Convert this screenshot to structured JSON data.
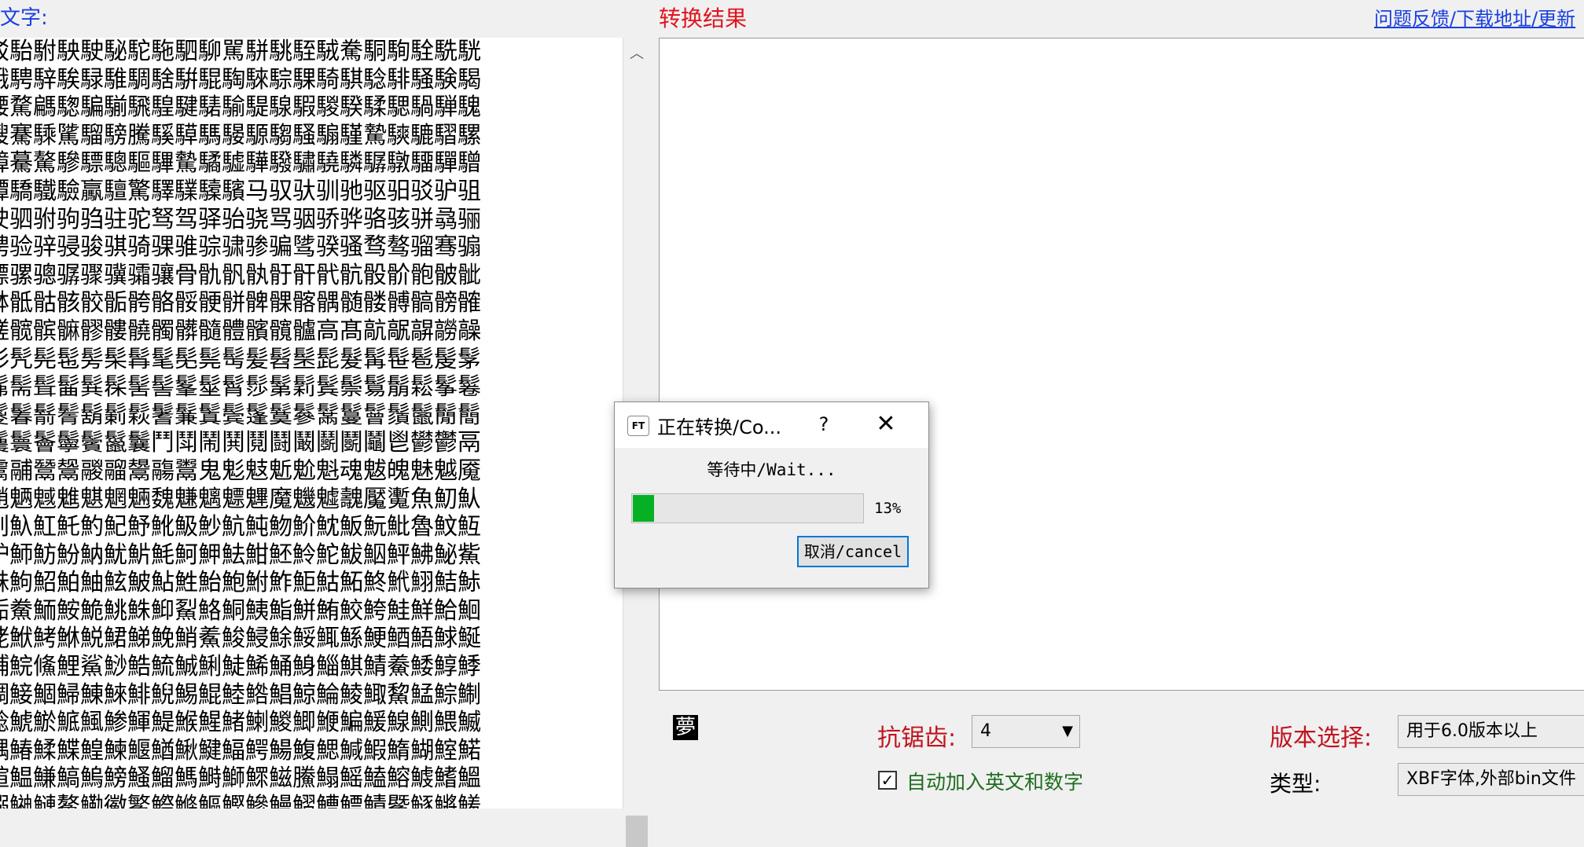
{
  "source_label": "文字:",
  "result_label": "转换结果",
  "feedback_link": "问题反馈/下载地址/更新",
  "source_text": "駁駘駙駚駛駜駝駞駟駠駡駢駣駤駥駦駧駨駩駪駫\n騀騁騂騃騄騅騆騇騈騉騊騋騌騍騎騏騐騑騒験騔\n騕騖騗騘騙騚騛騜騝騞騟騠騡騢騣騤騥騦騧騨騩\n騪騫騬騭騮騯騰騱騲騳騴騵騶騷騸騹騺騻騼騽騾\n騿驀驁驂驃驄驅驆驇驈驉驊驋驌驍驎驏驐驑驒驓\n驔驕驖驗驘驙驚驛驜驝驞马驭驮驯驰驱驲驳驴驵\n驶驷驸驹驺驻驼驽驾驿骀骁骂骃骄骅骆骇骈骉骊\n骋验骍骎骏骐骑骒骓骔骕骖骗骘骙骚骛骜骝骞骟\n骠骡骢骣骤骥骦骧骨骩骪骫骬骭骮骯骰骱骲骳骴\n骵骶骷骸骹骺骻骼骽骾骿髀髁髂髃髄髅髆髇髈髉\n髊髋髌髍髎髏髐髑髒髓體髕髖髗高髙髚髛髜髝髞\n髟髠髡髢髣髤髥髦髧髨髩髪髫髬髭髮髯髰髱髲髳\n髴髵髶髷髸髹髺髻髼髽髾髿鬀鬁鬂鬃鬄鬅鬆鬇鬈\n鬉鬊鬋鬌鬍鬎鬏鬐鬑鬒鬓鬔鬕鬖鬗鬘鬙鬚鬛鬜鬝\n鬞鬟鬠鬡鬢鬣鬤鬥鬦鬧鬨鬩鬪鬫鬬鬭鬮鬯鬰鬱鬲\n鬳鬴鬵鬶鬷鬸鬹鬺鬻鬼鬽鬾鬿魀魁魂魃魄魅魆魇\n魈魉魊魋魌魍魎魏魐魑魒魓魔魕魖魗魘魙魚魛魜\n魝魞魟魠魡魢魣魤魥魦魧魨魩魪魫魬魭魮魯魰魱\n魲魳魴魵魶魷魸魹魺魻魼魽魾魿鮀鮁鮂鮃鮄鮅鮆\n鮇鮈鮉鮊鮋鮌鮍鮎鮏鮐鮑鮒鮓鮔鮕鮖鮗鮘鮙鮚鮛\n鮜鮝鮞鮟鮠鮡鮢鮣鮤鮥鮦鮧鮨鮩鮪鮫鮬鮭鮮鮯鮰\n鮱鮲鮳鮴鮵鮶鮷鮸鮹鮺鮻鮼鮽鮾鮿鯀鯁鯂鯃鯄鯅\n鯆鯇鯈鯉鯊鯋鯌鯍鯎鯏鯐鯑鯒鯓鯔鯕鯖鯗鯘鯙鯚\n鯛鯜鯝鯞鯟鯠鯡鯢鯣鯤鯥鯦鯧鯨鯩鯪鯫鯬鯭鯮鯯\n鯰鯱鯲鯳鯴鯵鯶鯷鯸鯹鯺鯻鯼鯽鯾鯿鰀鰁鰂鰃鰄\n鰅鰆鰇鰈鰉鰊鰋鰌鰍鰎鰏鰐鰑鰒鰓鰔鰕鰖鰗鰘鰙\n鰚鰛鰜鰝鰞鰟鰠鰡鰢鰣鰤鰥鰦鰧鰨鰩鰪鰫鰬鰭鰮\n鰯鰰鰱鰲鰳鰴鰵鰶鰷鰸鰹鰺鰻鰼鰽鰾鰿鱀鱁鱂鱃\n鱄鱅鱆鱇鱈鱉鱊鱋鱌鱍鱎鱏鱐鱑鱒鱓鱔鱕鱖鱗鱘\n鱙鱚鱛鱜鱝鱞鱟鱠鱡鱢鱣鱤鱥鱦鱧鱨鱩鱪鱫鱬鱭",
  "preview_glyph": "夢",
  "antialias_label": "抗锯齿:",
  "antialias_value": "4",
  "version_label": "版本选择:",
  "version_value": "用于6.0版本以上",
  "type_label": "类型:",
  "type_value": "XBF字体,外部bin文件",
  "auto_add_label": "自动加入英文和数字",
  "auto_add_checked": "✓",
  "dialog": {
    "icon_text": "FT",
    "title": "正在转换/Co...",
    "help": "?",
    "close": "✕",
    "status": "等待中/Wait...",
    "progress_fraction": 0.1,
    "percent": "13%",
    "cancel": "取消/cancel"
  }
}
